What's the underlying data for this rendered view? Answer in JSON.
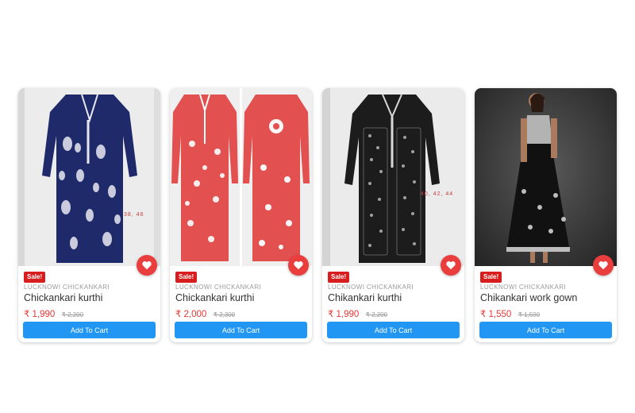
{
  "products": [
    {
      "badge": "Sale!",
      "brand": "LUCKNOWI CHICKANKARI",
      "title": "Chickankari kurthi",
      "price": "₹ 1,990",
      "mrp": "₹ 2,200",
      "sizes": "38, 46",
      "cart_label": "Add To Cart",
      "image_alt": "navy blue chikankari kurti on mannequin",
      "colors": {
        "garment": "#1f2a6b",
        "embroidery": "#e8e8f0",
        "bg": "#ececec"
      }
    },
    {
      "badge": "Sale!",
      "brand": "LUCKNOWI CHICKANKARI",
      "title": "Chickankari kurthi",
      "price": "₹ 2,000",
      "mrp": "₹ 2,300",
      "cart_label": "Add To Cart",
      "image_alt": "coral red chikankari kurti front and back",
      "colors": {
        "garment": "#e2504f",
        "embroidery": "#ffffff",
        "bg": "#efefef"
      }
    },
    {
      "badge": "Sale!",
      "brand": "LUCKNOWI CHICKANKARI",
      "title": "Chikankari kurthi",
      "price": "₹ 1,990",
      "mrp": "₹ 2,200",
      "sizes": "40, 42, 44",
      "cart_label": "Add To Cart",
      "image_alt": "black chikankari kurti on mannequin",
      "colors": {
        "garment": "#1c1c1c",
        "embroidery": "#d8d8d8",
        "bg": "#ebebeb"
      }
    },
    {
      "badge": "Sale!",
      "brand": "LUCKNOWI CHICKANKARI",
      "title": "Chikankari work gown",
      "price": "₹ 1,550",
      "mrp": "₹ 1,590",
      "cart_label": "Add To Cart",
      "image_alt": "model wearing black chikankari gown",
      "colors": {
        "garment": "#111111",
        "embroidery": "#d0d0d0",
        "bg": "#3a3a3a"
      }
    }
  ],
  "icons": {
    "wishlist": "heart-icon"
  },
  "accent": {
    "sale": "#d71d1d",
    "price": "#e53935",
    "button": "#2196f3",
    "wishlist": "#ea3d3d"
  }
}
